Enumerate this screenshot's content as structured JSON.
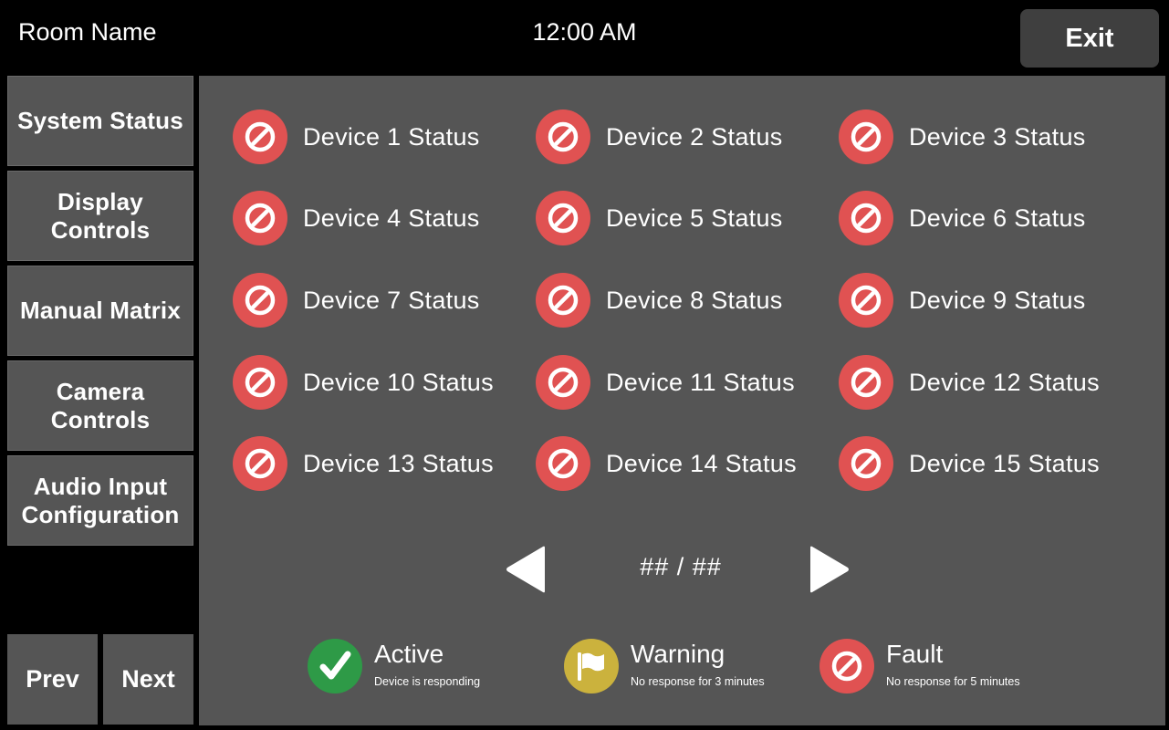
{
  "header": {
    "room_name": "Room Name",
    "time": "12:00 AM",
    "exit_label": "Exit"
  },
  "sidebar": {
    "items": [
      {
        "label": "System Status"
      },
      {
        "label": "Display Controls"
      },
      {
        "label": "Manual Matrix"
      },
      {
        "label": "Camera Controls"
      },
      {
        "label": "Audio Input Configuration"
      }
    ],
    "prev_label": "Prev",
    "next_label": "Next"
  },
  "devices": [
    {
      "label": "Device 1 Status",
      "state": "fault"
    },
    {
      "label": "Device 2 Status",
      "state": "fault"
    },
    {
      "label": "Device 3 Status",
      "state": "fault"
    },
    {
      "label": "Device 4 Status",
      "state": "fault"
    },
    {
      "label": "Device 5 Status",
      "state": "fault"
    },
    {
      "label": "Device 6 Status",
      "state": "fault"
    },
    {
      "label": "Device 7 Status",
      "state": "fault"
    },
    {
      "label": "Device 8 Status",
      "state": "fault"
    },
    {
      "label": "Device 9 Status",
      "state": "fault"
    },
    {
      "label": "Device 10 Status",
      "state": "fault"
    },
    {
      "label": "Device 11 Status",
      "state": "fault"
    },
    {
      "label": "Device 12 Status",
      "state": "fault"
    },
    {
      "label": "Device 13 Status",
      "state": "fault"
    },
    {
      "label": "Device 14 Status",
      "state": "fault"
    },
    {
      "label": "Device 15 Status",
      "state": "fault"
    }
  ],
  "pagination": {
    "counter": "## / ##",
    "prev_icon": "triangle-left-icon",
    "next_icon": "triangle-right-icon"
  },
  "legend": {
    "active": {
      "title": "Active",
      "desc": "Device is responding",
      "icon": "checkmark-icon",
      "color": "#2e9a47"
    },
    "warning": {
      "title": "Warning",
      "desc": "No response for 3 minutes",
      "icon": "flag-icon",
      "color": "#cbb23d"
    },
    "fault": {
      "title": "Fault",
      "desc": "No response for 5 minutes",
      "icon": "prohibited-icon",
      "color": "#e05252"
    }
  },
  "colors": {
    "background": "#000000",
    "panel": "#555555",
    "button": "#555555",
    "exit_button": "#3f3f3f"
  }
}
